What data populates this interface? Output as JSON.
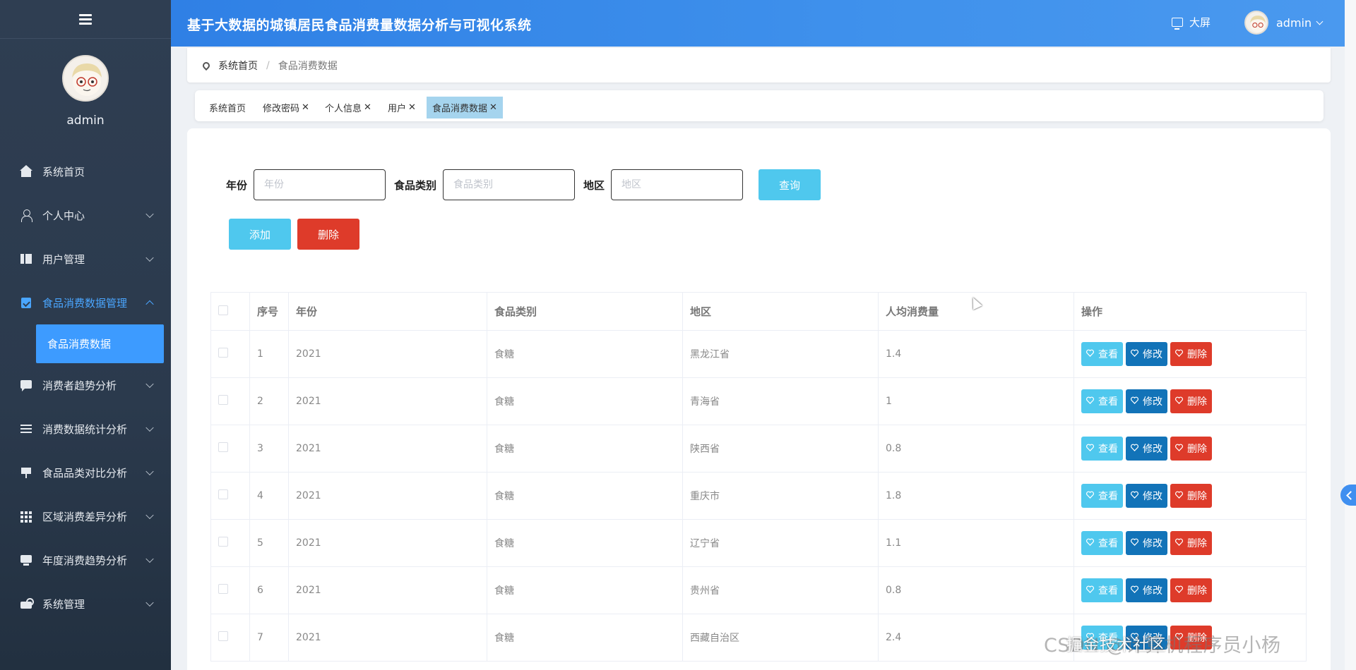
{
  "app": {
    "title": "基于大数据的城镇居民食品消费量数据分析与可视化系统"
  },
  "header": {
    "bigscreen_label": "大屏",
    "user_name": "admin"
  },
  "sidebar": {
    "user_name": "admin",
    "items": [
      {
        "label": "系统首页",
        "icon": "home-icon",
        "has_children": false
      },
      {
        "label": "个人中心",
        "icon": "user-icon",
        "has_children": true
      },
      {
        "label": "用户管理",
        "icon": "box-icon",
        "has_children": true
      },
      {
        "label": "食品消费数据管理",
        "icon": "clipboard-icon",
        "has_children": true,
        "active": true,
        "children": [
          {
            "label": "食品消费数据"
          }
        ]
      },
      {
        "label": "消费者趋势分析",
        "icon": "chat-icon",
        "has_children": true
      },
      {
        "label": "消费数据统计分析",
        "icon": "list-icon",
        "has_children": true
      },
      {
        "label": "食品品类对比分析",
        "icon": "flag-icon",
        "has_children": true
      },
      {
        "label": "区域消费差异分析",
        "icon": "grid-icon",
        "has_children": true
      },
      {
        "label": "年度消费趋势分析",
        "icon": "tv-icon",
        "has_children": true
      },
      {
        "label": "系统管理",
        "icon": "gear-icon",
        "has_children": true
      }
    ]
  },
  "breadcrumb": {
    "home": "系统首页",
    "separator": "/",
    "current": "食品消费数据"
  },
  "tabs": [
    {
      "label": "系统首页",
      "closable": false
    },
    {
      "label": "修改密码",
      "closable": true
    },
    {
      "label": "个人信息",
      "closable": true
    },
    {
      "label": "用户",
      "closable": true
    },
    {
      "label": "食品消费数据",
      "closable": true,
      "active": true
    }
  ],
  "tab_close_glyph": "✕",
  "search": {
    "year_label": "年份",
    "year_placeholder": "年份",
    "category_label": "食品类别",
    "category_placeholder": "食品类别",
    "region_label": "地区",
    "region_placeholder": "地区",
    "query_button": "查询"
  },
  "actions": {
    "add_button": "添加",
    "delete_button": "删除"
  },
  "table": {
    "columns": [
      "序号",
      "年份",
      "食品类别",
      "地区",
      "人均消费量",
      "操作"
    ],
    "rows": [
      {
        "index": "1",
        "year": "2021",
        "category": "食糖",
        "region": "黑龙江省",
        "per_capita": "1.4"
      },
      {
        "index": "2",
        "year": "2021",
        "category": "食糖",
        "region": "青海省",
        "per_capita": "1"
      },
      {
        "index": "3",
        "year": "2021",
        "category": "食糖",
        "region": "陕西省",
        "per_capita": "0.8"
      },
      {
        "index": "4",
        "year": "2021",
        "category": "食糖",
        "region": "重庆市",
        "per_capita": "1.8"
      },
      {
        "index": "5",
        "year": "2021",
        "category": "食糖",
        "region": "辽宁省",
        "per_capita": "1.1"
      },
      {
        "index": "6",
        "year": "2021",
        "category": "食糖",
        "region": "贵州省",
        "per_capita": "0.8"
      },
      {
        "index": "7",
        "year": "2021",
        "category": "食糖",
        "region": "西藏自治区",
        "per_capita": "2.4"
      }
    ],
    "row_actions": {
      "view": "查看",
      "edit": "修改",
      "delete": "删除"
    }
  },
  "watermark": {
    "back_text": "CSDN @计算机程序员小杨",
    "front_text": "掘金技术社区"
  },
  "colors": {
    "accent": "#3d9bff",
    "info": "#4fc8ee",
    "primary": "#1273b8",
    "danger": "#de3b2a",
    "tab_active": "#a5d4ee"
  }
}
